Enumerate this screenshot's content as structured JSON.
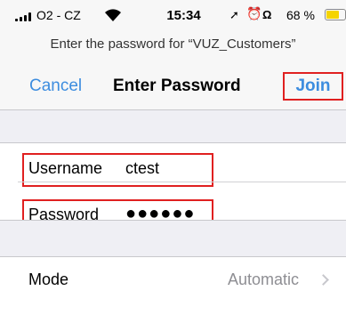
{
  "status_bar": {
    "carrier": "O2 - CZ",
    "time": "15:34",
    "battery_percent": "68 %",
    "battery_level": 0.68,
    "battery_color": "#f5d400",
    "icons": [
      "signal-icon",
      "wifi-icon",
      "location-icon",
      "alarm-icon",
      "headphones-icon",
      "battery-icon"
    ]
  },
  "nav": {
    "prompt": "Enter the password for “VUZ_Customers”",
    "cancel_label": "Cancel",
    "title": "Enter Password",
    "join_label": "Join"
  },
  "form": {
    "username_label": "Username",
    "username_value": "ctest",
    "password_label": "Password",
    "password_value": "●●●●●●"
  },
  "mode": {
    "label": "Mode",
    "value": "Automatic"
  },
  "colors": {
    "accent": "#3d8ddf",
    "highlight": "#e02020"
  }
}
